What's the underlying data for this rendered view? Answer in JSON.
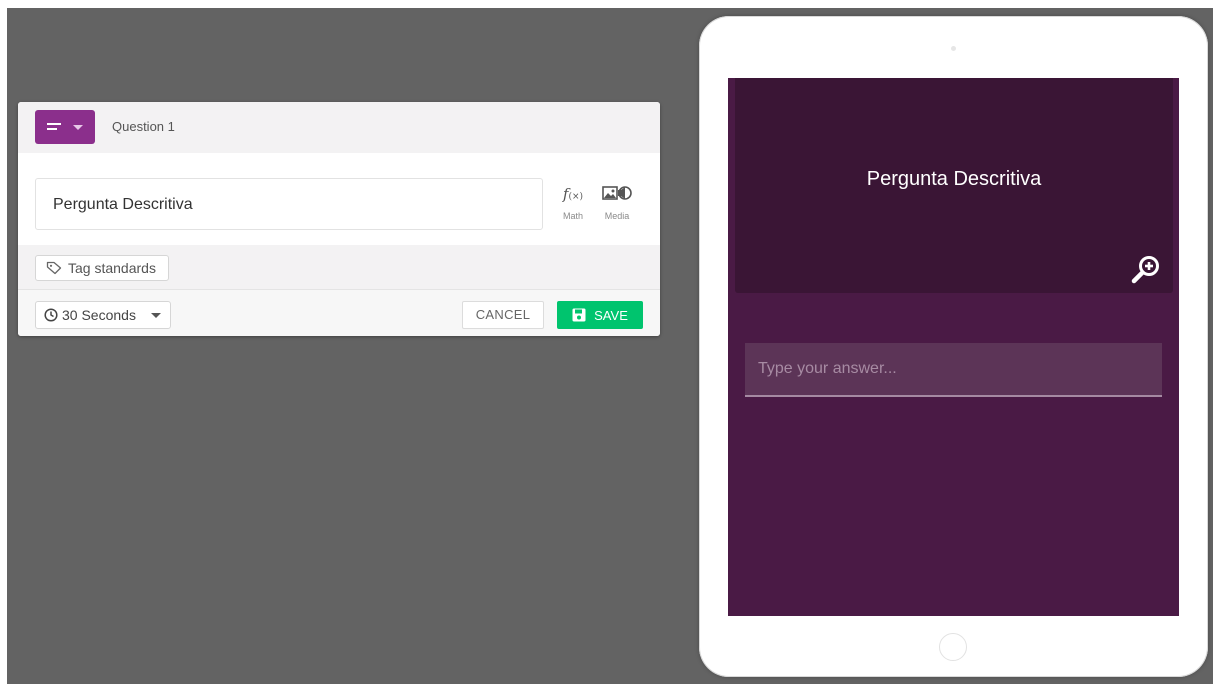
{
  "editor": {
    "question_label": "Question 1",
    "question_text": "Pergunta Descritiva",
    "tools": {
      "math_label": "Math",
      "media_label": "Media"
    },
    "tag_button_label": "Tag standards",
    "timer": {
      "selected": "30 Seconds"
    },
    "cancel_label": "CANCEL",
    "save_label": "SAVE"
  },
  "preview": {
    "question_text": "Pergunta Descritiva",
    "answer_placeholder": "Type your answer..."
  },
  "colors": {
    "backdrop": "#636363",
    "type_button": "#8b2f8c",
    "save_button": "#00c46e",
    "preview_background": "#4a1a45",
    "preview_question_box": "#3a1535"
  },
  "icons": [
    "question-type-icon",
    "math-function-icon",
    "media-icon",
    "tag-icon",
    "clock-icon",
    "save-icon",
    "zoom-in-icon"
  ]
}
